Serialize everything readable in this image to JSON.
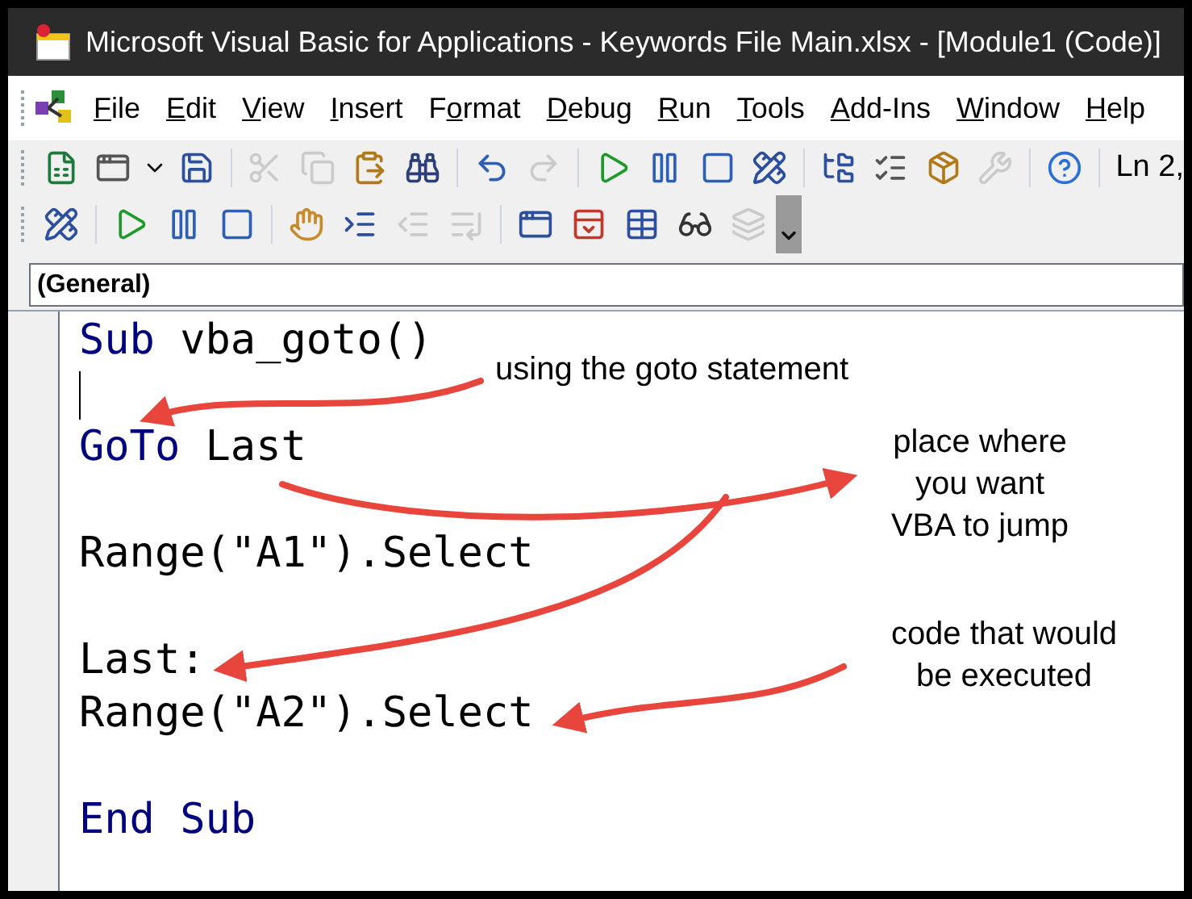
{
  "window": {
    "title": "Microsoft Visual Basic for Applications - Keywords File Main.xlsx - [Module1 (Code)]"
  },
  "menu": [
    {
      "key": "F",
      "rest": "ile"
    },
    {
      "key": "E",
      "rest": "dit"
    },
    {
      "key": "V",
      "rest": "iew"
    },
    {
      "key": "I",
      "rest": "nsert"
    },
    {
      "lead": "F",
      "key": "o",
      "rest": "rmat"
    },
    {
      "key": "D",
      "rest": "ebug"
    },
    {
      "key": "R",
      "rest": "un"
    },
    {
      "key": "T",
      "rest": "ools"
    },
    {
      "key": "A",
      "rest": "dd-Ins"
    },
    {
      "key": "W",
      "rest": "indow"
    },
    {
      "key": "H",
      "rest": "elp"
    }
  ],
  "toolbar_1": {
    "buttons": [
      {
        "kind": "excel",
        "disabled": false
      },
      {
        "kind": "form",
        "disabled": false
      },
      {
        "kind": "caret",
        "disabled": false
      },
      {
        "kind": "save",
        "disabled": false
      },
      {
        "kind": "sep"
      },
      {
        "kind": "cut",
        "disabled": true
      },
      {
        "kind": "copy",
        "disabled": true
      },
      {
        "kind": "paste",
        "disabled": false
      },
      {
        "kind": "find",
        "disabled": false
      },
      {
        "kind": "sep"
      },
      {
        "kind": "undo",
        "disabled": false
      },
      {
        "kind": "redo",
        "disabled": true
      },
      {
        "kind": "sep"
      },
      {
        "kind": "run",
        "disabled": false
      },
      {
        "kind": "pause",
        "disabled": false
      },
      {
        "kind": "stop",
        "disabled": false
      },
      {
        "kind": "design",
        "disabled": false
      },
      {
        "kind": "sep"
      },
      {
        "kind": "project",
        "disabled": false
      },
      {
        "kind": "properties",
        "disabled": false
      },
      {
        "kind": "browser",
        "disabled": false
      },
      {
        "kind": "toolbox",
        "disabled": true
      },
      {
        "kind": "sep"
      },
      {
        "kind": "help",
        "disabled": false
      },
      {
        "kind": "sep"
      }
    ],
    "position": "Ln 2,"
  },
  "toolbar_2": {
    "buttons": [
      {
        "kind": "design",
        "disabled": false
      },
      {
        "kind": "sep"
      },
      {
        "kind": "run",
        "disabled": false
      },
      {
        "kind": "pause",
        "disabled": false
      },
      {
        "kind": "stop",
        "disabled": false
      },
      {
        "kind": "sep"
      },
      {
        "kind": "breakpoint",
        "disabled": false
      },
      {
        "kind": "indent",
        "disabled": false
      },
      {
        "kind": "outdent",
        "disabled": true
      },
      {
        "kind": "stepout",
        "disabled": true
      },
      {
        "kind": "sep"
      },
      {
        "kind": "locals",
        "disabled": false
      },
      {
        "kind": "immediate",
        "disabled": false
      },
      {
        "kind": "watch",
        "disabled": false
      },
      {
        "kind": "quickwatch",
        "disabled": false
      },
      {
        "kind": "callstack",
        "disabled": true
      }
    ]
  },
  "object_box": {
    "value": "(General)"
  },
  "code_lines": [
    {
      "kind": "code",
      "tokens": [
        {
          "text": "Sub",
          "kind": "keyword"
        },
        {
          "text": " vba_goto()",
          "kind": "plain"
        }
      ]
    },
    {
      "kind": "cursor"
    },
    {
      "kind": "code",
      "tokens": [
        {
          "text": "GoTo",
          "kind": "keyword"
        },
        {
          "text": " Last",
          "kind": "plain"
        }
      ]
    },
    {
      "kind": "blank"
    },
    {
      "kind": "code",
      "tokens": [
        {
          "text": "Range(\"A1\").Select",
          "kind": "plain"
        }
      ]
    },
    {
      "kind": "blank"
    },
    {
      "kind": "code",
      "tokens": [
        {
          "text": "Last:",
          "kind": "plain"
        }
      ]
    },
    {
      "kind": "code",
      "tokens": [
        {
          "text": "Range(\"A2\").Select",
          "kind": "plain"
        }
      ]
    },
    {
      "kind": "blank"
    },
    {
      "kind": "code",
      "tokens": [
        {
          "text": "End Sub",
          "kind": "keyword"
        }
      ]
    }
  ],
  "annotations": [
    {
      "lines": [
        "using the goto statement"
      ]
    },
    {
      "lines": [
        "place where",
        "you want",
        "VBA to jump"
      ]
    },
    {
      "lines": [
        "code that would",
        "be executed"
      ]
    }
  ]
}
